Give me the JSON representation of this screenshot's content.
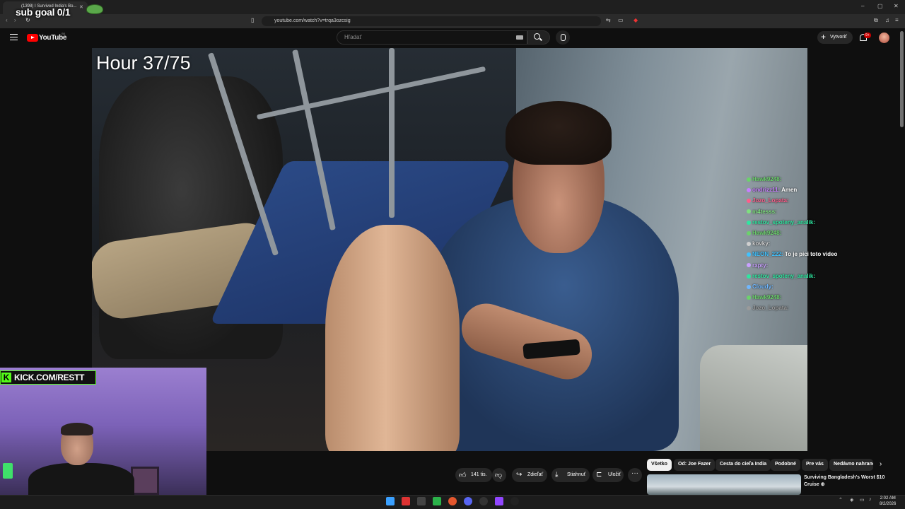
{
  "browser": {
    "tab_title": "(1398) I Survived India's Bo...",
    "url": "youtube.com/watch?v=trqa3ozcsig",
    "window_controls": [
      "–",
      "▢",
      "✕"
    ]
  },
  "overlay": {
    "sub_goal": "sub goal 0/1",
    "hour_label": "Hour 37/75",
    "kick_url": "KICK.COM/RESTT",
    "kick_letter": "K"
  },
  "youtube": {
    "brand": "YouTube",
    "region": "SK",
    "search_placeholder": "Hľadať",
    "create_label": "Vytvoriť",
    "notif_badge": "9+"
  },
  "chat": [
    {
      "user": "Hawk9248:",
      "msg": "",
      "color": "#6bd26b"
    },
    {
      "user": "ondrizz11:",
      "msg": "Amen",
      "color": "#c77dff"
    },
    {
      "user": "Jozo_Lopata:",
      "msg": "",
      "color": "#ff5c8a"
    },
    {
      "user": "m4tesss:",
      "msg": "",
      "color": "#7ee07e"
    },
    {
      "user": "restov_spoteny_analik:",
      "msg": "",
      "color": "#2ee6a0"
    },
    {
      "user": "Hawk9248:",
      "msg": "",
      "color": "#6bd26b"
    },
    {
      "user": "kovky:",
      "msg": "",
      "color": "#cfcfcf"
    },
    {
      "user": "NEON_222:",
      "msg": "To je pici toto video",
      "color": "#3fc2ff"
    },
    {
      "user": "rapty:",
      "msg": "",
      "color": "#c9a0ff"
    },
    {
      "user": "restov_spoteny_analik:",
      "msg": "",
      "color": "#2ee6a0"
    },
    {
      "user": "Cloudy:",
      "msg": "",
      "color": "#6fb7ff"
    },
    {
      "user": "Hawk9248:",
      "msg": "",
      "color": "#6bd26b"
    },
    {
      "user": "Jozo_Lopata:",
      "msg": "",
      "color": "#9a9a9a"
    }
  ],
  "actions": {
    "like_count": "141 tis.",
    "share": "Zdieľať",
    "download": "Stiahnuť",
    "save": "Uložiť",
    "more": "···"
  },
  "chips": [
    "Všetko",
    "Od: Joe Fazer",
    "Cesta do cieľa India",
    "Podobné",
    "Pre vás",
    "Nedávno nahrané"
  ],
  "recommendation": {
    "title": "Surviving Bangladesh's Worst $10 Cruise",
    "title_extra": "⊕"
  },
  "taskbar": {
    "time": "2:02 AM",
    "date": "8/2/2026"
  }
}
